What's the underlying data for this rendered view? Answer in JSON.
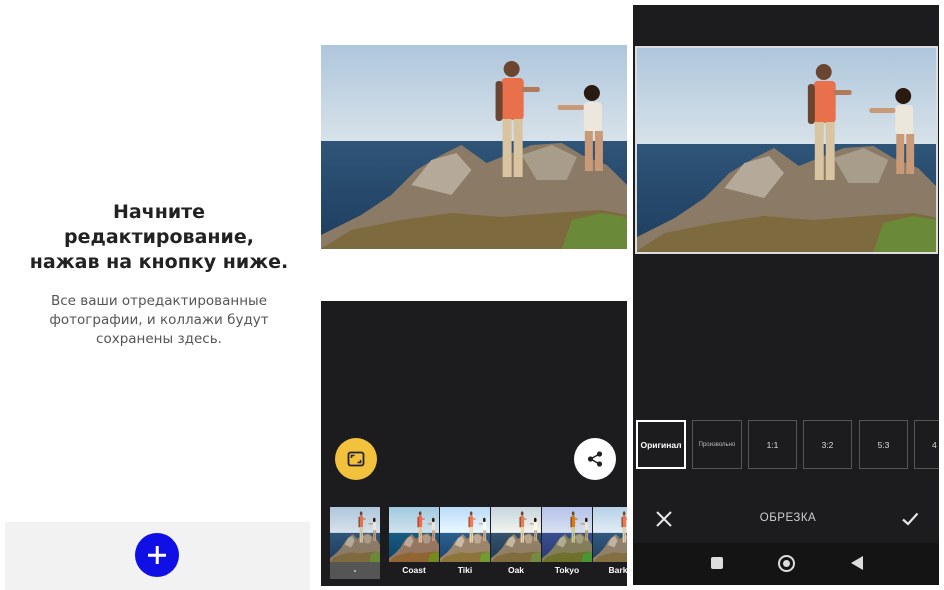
{
  "empty_screen": {
    "title_lines": [
      "Начните",
      "редактирование,",
      "нажав на кнопку ниже."
    ],
    "subtitle_lines": [
      "Все ваши отредактированные",
      "фотографии, и коллажи будут",
      "сохранены здесь."
    ],
    "add_icon": "plus-icon",
    "accent_color": "#1010e6"
  },
  "editor_screen": {
    "fit_icon": "aspect-ratio-icon",
    "fit_color": "#f2c23d",
    "share_icon": "share-icon",
    "filters": [
      {
        "label": "-",
        "selected": true
      },
      {
        "label": "Coast",
        "selected": false
      },
      {
        "label": "Tiki",
        "selected": false
      },
      {
        "label": "Oak",
        "selected": false
      },
      {
        "label": "Tokyo",
        "selected": false
      },
      {
        "label": "Bark",
        "selected": false
      }
    ]
  },
  "crop_screen": {
    "ratios": [
      {
        "label": "Оригинал",
        "active": true
      },
      {
        "label": "Произвольно",
        "active": false
      },
      {
        "label": "1:1",
        "active": false
      },
      {
        "label": "3:2",
        "active": false
      },
      {
        "label": "5:3",
        "active": false
      },
      {
        "label": "4",
        "active": false
      }
    ],
    "title": "ОБРЕЗКА",
    "cancel_icon": "close-icon",
    "confirm_icon": "check-icon",
    "nav_icons": [
      "recents-square-icon",
      "home-circle-icon",
      "back-triangle-icon"
    ]
  }
}
